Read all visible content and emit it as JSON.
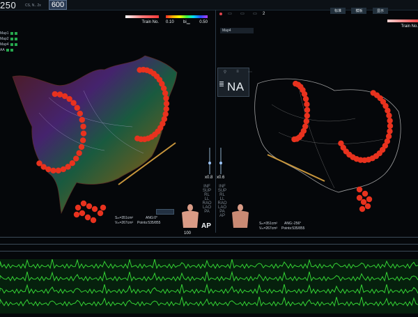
{
  "header": {
    "big_count": "250",
    "counter": "600",
    "small_info": "CS, N.. 2x",
    "tabs": [
      "标准",
      "模板",
      "显示"
    ]
  },
  "left_view": {
    "colorbar_label": "Train No.",
    "scale_low": "0.10",
    "scale_unit": "bi",
    "scale_unit_sub": "mv",
    "scale_high": "0.50",
    "map_list": [
      "",
      "Map1",
      "Map2",
      "Map4",
      "AA"
    ],
    "stats": {
      "area": "Sₘ=351cm²",
      "volume": "Vₘ=267cm³",
      "angle": "ANG:0°",
      "points": "Points:535/855"
    }
  },
  "right_view": {
    "colorbar_label": "Train No.",
    "map_name": "Map4",
    "toolbar_count": "2",
    "stats": {
      "area": "Sₘ=351cm²",
      "volume": "Vₘ=267cm³",
      "angle": "ANG:-256°",
      "points": "Points:535/855"
    }
  },
  "center": {
    "na_label": "NA",
    "zoom_left": "x0.8",
    "zoom_right": "x0.6",
    "views": [
      "INF",
      "SUP",
      "RL",
      "LL",
      "RAO",
      "LAO",
      "PA",
      "AP"
    ],
    "current_view": "AP",
    "scale_value": "100"
  },
  "colors": {
    "points": "#e8321e",
    "catheter": "#c8963c",
    "ecg": "#35d435",
    "background": "#05070a"
  }
}
